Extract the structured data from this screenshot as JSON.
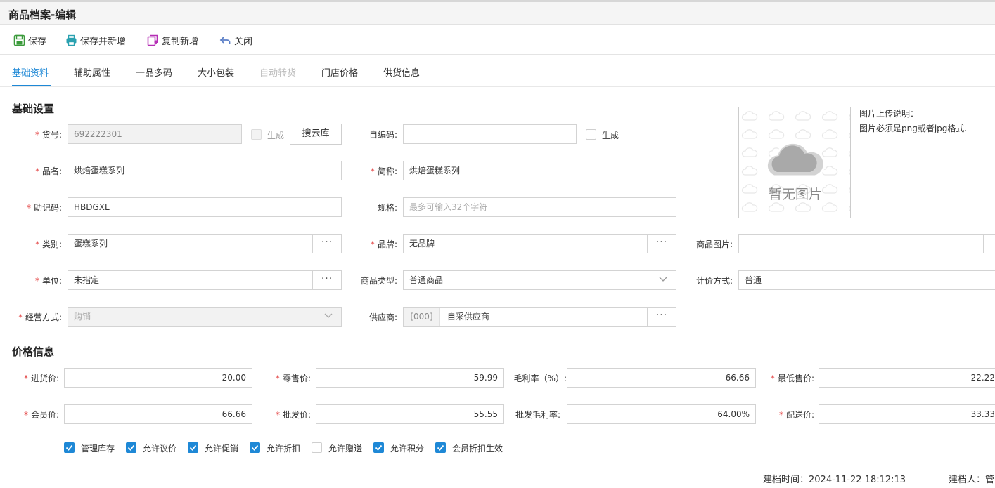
{
  "window": {
    "title": "商品档案-编辑"
  },
  "toolbar": {
    "save": "保存",
    "save_new": "保存并新增",
    "copy_new": "复制新增",
    "close": "关闭"
  },
  "tabs": [
    "基础资料",
    "辅助属性",
    "一品多码",
    "大小包装",
    "自动转货",
    "门店价格",
    "供货信息"
  ],
  "basic": {
    "section": "基础设置",
    "code_label": "货号:",
    "code_value": "692222301",
    "code_gen": "生成",
    "search_cloud": "搜云库",
    "selfcode_label": "自编码:",
    "selfcode_value": "",
    "selfcode_gen": "生成",
    "name_label": "品名:",
    "name_value": "烘焙蛋糕系列",
    "short_label": "简称:",
    "short_value": "烘焙蛋糕系列",
    "mnemonic_label": "助记码:",
    "mnemonic_value": "HBDGXL",
    "spec_label": "规格:",
    "spec_placeholder": "最多可输入32个字符",
    "category_label": "类别:",
    "category_value": "蛋糕系列",
    "brand_label": "品牌:",
    "brand_value": "无品牌",
    "image_label": "商品图片:",
    "image_value": "",
    "unit_label": "单位:",
    "unit_value": "未指定",
    "type_label": "商品类型:",
    "type_value": "普通商品",
    "pricing_label": "计价方式:",
    "pricing_value": "普通",
    "business_label": "经营方式:",
    "business_value": "购销",
    "supplier_label": "供应商:",
    "supplier_code": "[000]",
    "supplier_value": "自采供应商",
    "dots": "···",
    "no_image": "暂无图片",
    "upload_title": "图片上传说明：",
    "upload_desc": "图片必须是png或者jpg格式."
  },
  "price": {
    "section": "价格信息",
    "purchase_label": "进货价:",
    "purchase_value": "20.00",
    "retail_label": "零售价:",
    "retail_value": "59.99",
    "margin_label": "毛利率（%）:",
    "margin_value": "66.66",
    "min_label": "最低售价:",
    "min_value": "22.22",
    "member_label": "会员价:",
    "member_value": "66.66",
    "wholesale_label": "批发价:",
    "wholesale_value": "55.55",
    "wmargin_label": "批发毛利率:",
    "wmargin_value": "64.00%",
    "delivery_label": "配送价:",
    "delivery_value": "33.33"
  },
  "options": [
    {
      "label": "管理库存",
      "checked": true
    },
    {
      "label": "允许议价",
      "checked": true
    },
    {
      "label": "允许促销",
      "checked": true
    },
    {
      "label": "允许折扣",
      "checked": true
    },
    {
      "label": "允许赠送",
      "checked": false
    },
    {
      "label": "允许积分",
      "checked": true
    },
    {
      "label": "会员折扣生效",
      "checked": true
    }
  ],
  "footer": {
    "created_time": "建档时间：2024-11-22 18:12:13",
    "creator": "建档人：管"
  },
  "colors": {
    "accent": "#1e88d6",
    "required": "#e23c3c"
  }
}
